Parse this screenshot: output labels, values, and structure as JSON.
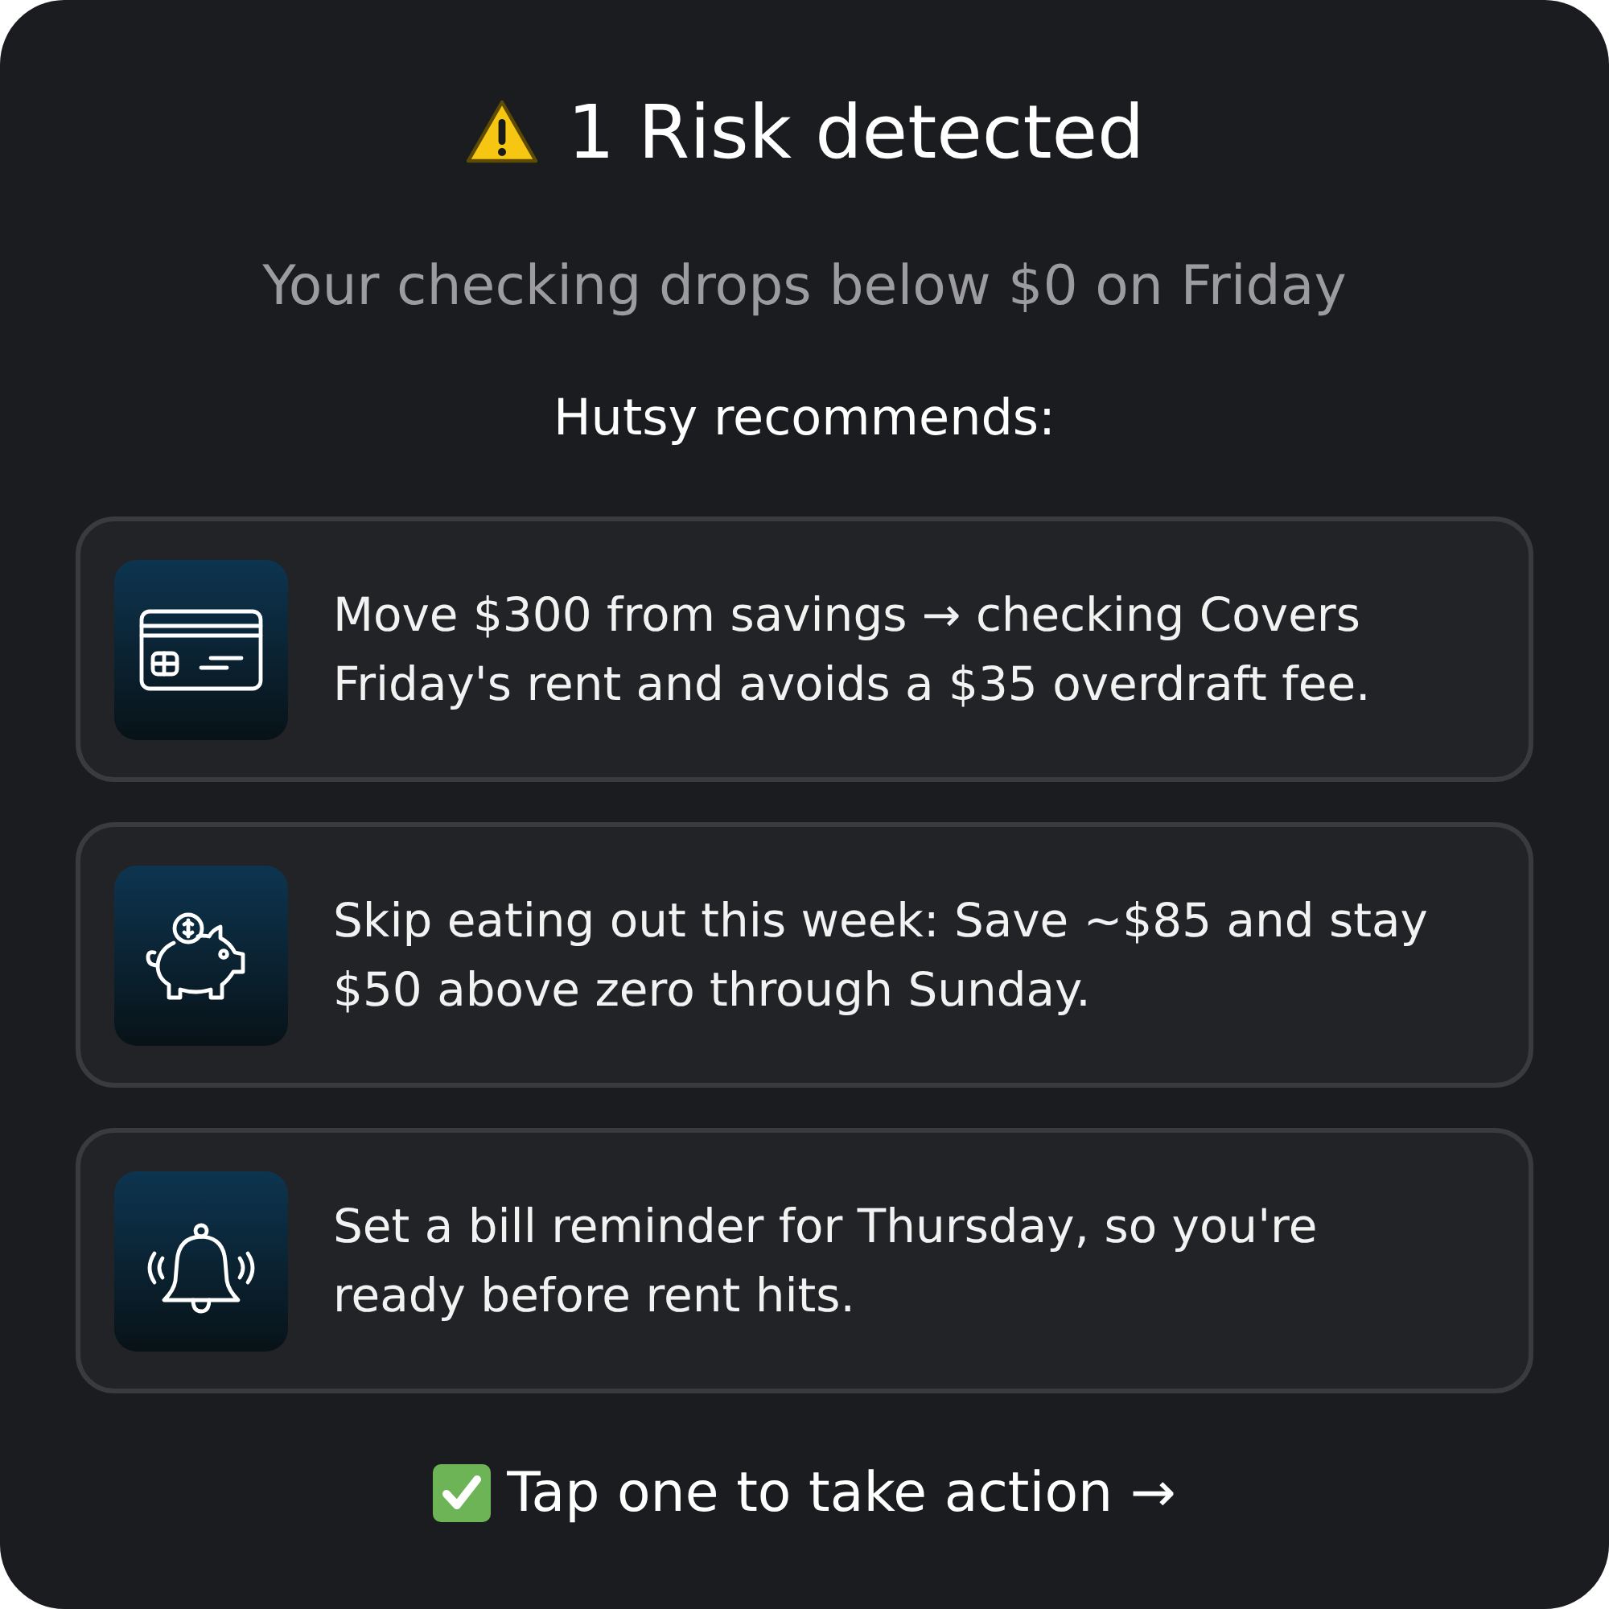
{
  "header": {
    "title": "1 Risk detected",
    "subtitle": "Your checking drops below $0 on Friday"
  },
  "recommendations": {
    "heading": "Hutsy recommends:",
    "items": [
      {
        "kind": "card",
        "text": "Move $300 from savings → checking Covers Friday's rent and avoids a $35 overdraft fee."
      },
      {
        "kind": "savings",
        "text": "Skip eating out this week: Save ~$85 and stay $50 above zero through Sunday."
      },
      {
        "kind": "reminder",
        "text": "Set a bill reminder for Thursday, so you're ready before rent hits."
      }
    ]
  },
  "footer": {
    "text": "Tap one to take action →"
  }
}
